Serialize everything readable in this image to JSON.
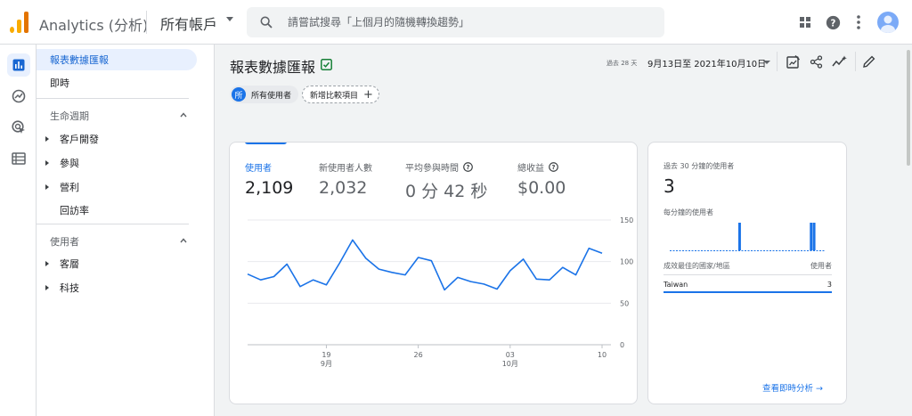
{
  "app": {
    "title": "Analytics (分析)",
    "account": "所有帳戶"
  },
  "search": {
    "placeholder": "請嘗試搜尋「上個月的隨機轉換趨勢」"
  },
  "icons": {
    "apps": "apps-grid-icon",
    "help": "help-icon",
    "more": "more-vert-icon",
    "avatar": "account-avatar",
    "rail": [
      "reports-icon",
      "explore-icon",
      "advertising-icon",
      "configure-icon"
    ],
    "header": [
      "customize-report-icon",
      "share-icon",
      "insights-icon",
      "edit-icon"
    ]
  },
  "nav": {
    "reports_snapshot": "報表數據匯報",
    "realtime": "即時",
    "lifecycle": {
      "title": "生命週期",
      "items": [
        "客戶開發",
        "參與",
        "營利",
        "回訪率"
      ]
    },
    "user": {
      "title": "使用者",
      "items": [
        "客層",
        "科技"
      ]
    }
  },
  "header": {
    "title": "報表數據匯報",
    "chip_all_badge": "所",
    "chip_all": "所有使用者",
    "chip_add": "新增比較項目",
    "range_prefix": "過去 28 天",
    "range": "9月13日至 2021年10月10日"
  },
  "metrics": [
    {
      "label": "使用者",
      "value": "2,109",
      "help": false
    },
    {
      "label": "新使用者人數",
      "value": "2,032",
      "help": false
    },
    {
      "label": "平均參與時間",
      "value": "0 分 42 秒",
      "help": true
    },
    {
      "label": "總收益",
      "value": "$0.00",
      "help": true
    }
  ],
  "chart_data": {
    "type": "line",
    "series": [
      {
        "values": [
          85,
          78,
          82,
          97,
          70,
          78,
          72,
          98,
          126,
          104,
          91,
          87,
          84,
          105,
          101,
          66,
          81,
          76,
          73,
          67,
          89,
          103,
          79,
          78,
          93,
          84,
          116,
          110
        ]
      }
    ],
    "ylim": [
      0,
      150
    ],
    "yticks": [
      "0",
      "50",
      "100",
      "150"
    ],
    "xticks": [
      {
        "day": "19",
        "month": "9月",
        "index": 6
      },
      {
        "day": "26",
        "month": "",
        "index": 13
      },
      {
        "day": "03",
        "month": "10月",
        "index": 20
      },
      {
        "day": "10",
        "month": "",
        "index": 27
      }
    ],
    "color": "#1a73e8",
    "grid": true
  },
  "realtime": {
    "label": "過去 30 分鐘的使用者",
    "value": "3",
    "per_minute_label": "每分鐘的使用者",
    "per_minute": [
      0,
      0,
      0,
      0,
      0,
      0,
      0,
      0,
      0,
      0,
      0,
      0,
      0,
      0,
      0,
      0,
      0,
      0,
      0,
      0,
      0,
      0,
      0,
      1,
      0,
      0,
      0,
      0,
      0,
      0,
      0,
      0,
      0,
      0,
      0,
      0,
      0,
      0,
      0,
      0,
      0,
      0,
      0,
      0,
      0,
      0,
      0,
      1,
      1,
      0,
      0,
      0
    ],
    "table_head": [
      "成效最佳的國家/地區",
      "使用者"
    ],
    "rows": [
      {
        "country": "Taiwan",
        "users": "3"
      }
    ],
    "link": "查看即時分析 →"
  }
}
